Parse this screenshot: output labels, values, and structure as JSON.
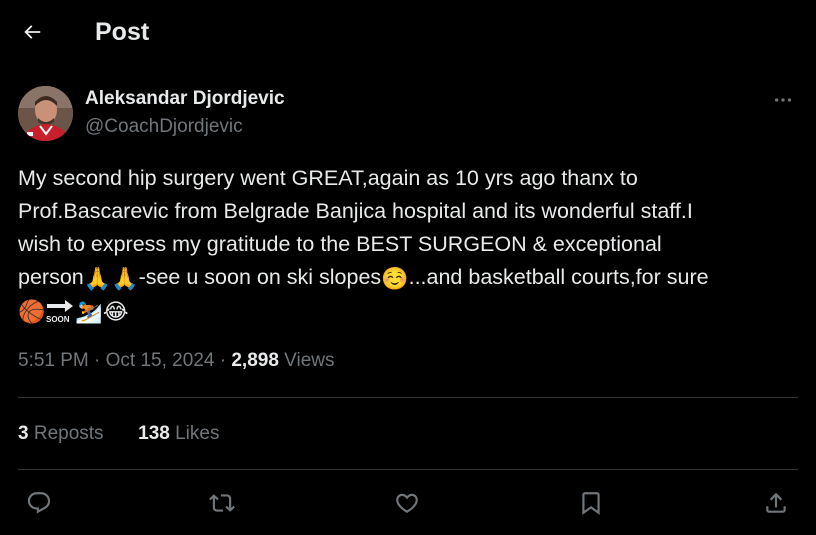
{
  "header": {
    "title": "Post",
    "back_icon": "arrow-left-icon"
  },
  "author": {
    "display_name": "Aleksandar Djordjevic",
    "handle": "@CoachDjordjevic"
  },
  "tweet": {
    "line1": "My second hip surgery went GREAT,again as 10 yrs ago thanx to",
    "line2": "Prof.Bascarevic from Belgrade Banjica hospital and its wonderful staff.I",
    "line3": "wish to express my gratitude to the BEST SURGEON & exceptional",
    "line4a": "person",
    "line4b": "-see u soon on ski slopes",
    "line4c": "...and basketball courts,for sure",
    "emojis": {
      "pray": "🙏",
      "smile": "☺️",
      "basketball": "🏀",
      "skier": "⛷️",
      "joy": "😂",
      "soon_label": "SOON"
    }
  },
  "meta": {
    "time": "5:51 PM",
    "sep1": " · ",
    "date": "Oct 15, 2024",
    "sep2": " · ",
    "views_count": "2,898",
    "views_label": " Views"
  },
  "stats": {
    "reposts_count": "3",
    "reposts_label": " Reposts",
    "likes_count": "138",
    "likes_label": " Likes"
  },
  "colors": {
    "background": "#000000",
    "text_primary": "#e7e9ea",
    "text_secondary": "#71767b",
    "divider": "#2f3336"
  }
}
